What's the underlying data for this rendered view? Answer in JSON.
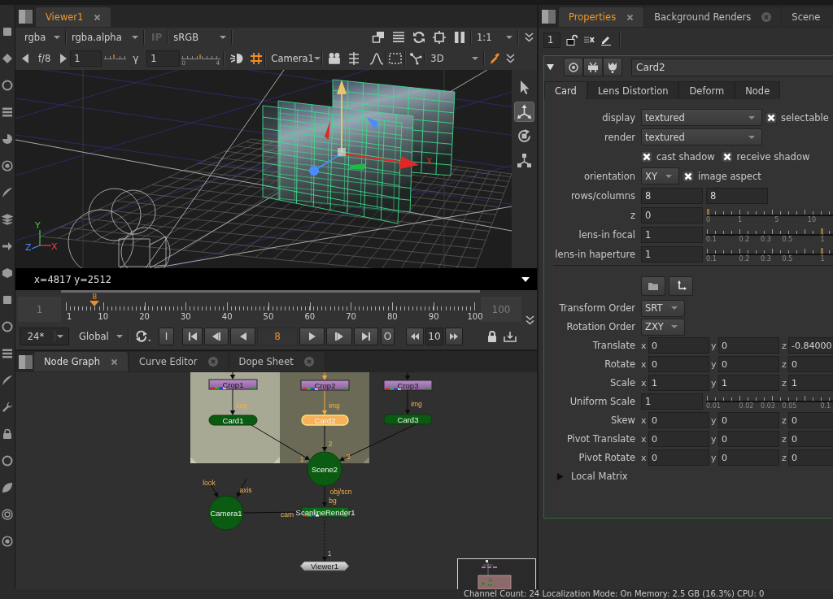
{
  "viewer": {
    "tab": {
      "label": "Viewer1",
      "selected": true,
      "closable": true
    },
    "toolbar": {
      "channels": "rgba",
      "alpha": "rgba.alpha",
      "input_process": {
        "label": "IP",
        "disabled": true
      },
      "colorspace": "sRGB",
      "zoom": "1:1"
    },
    "controls": {
      "fstop": "f/8",
      "gain": {
        "value": "1",
        "level": 0.45
      },
      "gamma": {
        "label": "γ",
        "value": "1",
        "level": 0.47,
        "ticks": [
          "0",
          "4"
        ]
      },
      "camera": "Camera1",
      "view_mode": "3D"
    },
    "viewport": {
      "tools": [
        {
          "selected": false
        },
        {
          "selected": true
        },
        {
          "selected": false
        },
        {
          "selected": false
        }
      ],
      "gizmo_label": "X",
      "axis_labels": [
        "Y",
        "Z",
        "X"
      ]
    },
    "info": "x=4817 y=2512",
    "timeline": {
      "start": "1",
      "end": "100",
      "ticks": [
        "1",
        "10",
        "20",
        "30",
        "40",
        "50",
        "60",
        "70",
        "80",
        "90",
        "100"
      ],
      "current": "8",
      "level": 0.07
    },
    "playback": {
      "fps": "24*",
      "range": "Global",
      "in_label": "I",
      "frame": "8",
      "out_label": "O",
      "increment": "10"
    }
  },
  "node_graph": {
    "tabs": [
      {
        "label": "Node Graph",
        "selected": true,
        "closable": true
      },
      {
        "label": "Curve Editor",
        "selected": false,
        "closable": true
      },
      {
        "label": "Dope Sheet",
        "selected": false,
        "closable": true
      }
    ],
    "nodes": [
      {
        "kind": "crop",
        "label": "Crop1",
        "selected": false
      },
      {
        "kind": "crop",
        "label": "Crop2",
        "selected": false
      },
      {
        "kind": "crop",
        "label": "Crop3",
        "selected": false
      },
      {
        "kind": "card",
        "label": "Card1",
        "selected": false,
        "inputs": [
          "img"
        ]
      },
      {
        "kind": "card",
        "label": "Card2",
        "selected": true,
        "inputs": [
          "img"
        ]
      },
      {
        "kind": "card",
        "label": "Card3",
        "selected": false,
        "inputs": [
          "img"
        ]
      },
      {
        "kind": "scene",
        "label": "Scene2",
        "selected": false,
        "inputs": [
          "1",
          "2",
          "3"
        ]
      },
      {
        "kind": "camera",
        "label": "Camera1",
        "selected": false,
        "inputs": [
          "look",
          "axis"
        ]
      },
      {
        "kind": "render",
        "label": "ScanlineRender1",
        "selected": false,
        "inputs": [
          "obj/scn",
          "bg",
          "cam"
        ]
      },
      {
        "kind": "viewer",
        "label": "Viewer1",
        "selected": false,
        "inputs": [
          "1"
        ]
      }
    ]
  },
  "properties": {
    "tabs": [
      {
        "label": "Properties",
        "selected": true,
        "closable": true
      },
      {
        "label": "Background Renders",
        "selected": false,
        "closable": true
      },
      {
        "label": "Scene",
        "selected": false,
        "closable": false
      }
    ],
    "max_panels": "1",
    "node": {
      "name": "Card2",
      "expanded": true,
      "tabs": [
        {
          "label": "Card",
          "selected": true
        },
        {
          "label": "Lens Distortion",
          "selected": false
        },
        {
          "label": "Deform",
          "selected": false
        },
        {
          "label": "Node",
          "selected": false
        }
      ],
      "knobs": [
        {
          "kind": "dropdown",
          "label": "display",
          "value": "textured",
          "checkbox": {
            "label": "selectable",
            "checked": true
          }
        },
        {
          "kind": "dropdown",
          "label": "render",
          "value": "textured"
        },
        {
          "kind": "checkboxes",
          "items": [
            {
              "label": "cast shadow",
              "checked": true
            },
            {
              "label": "receive shadow",
              "checked": true
            }
          ]
        },
        {
          "kind": "dropdown",
          "label": "orientation",
          "value": "XY",
          "checkbox": {
            "label": "image aspect",
            "checked": true
          }
        },
        {
          "kind": "pair",
          "label": "rows/columns",
          "values": [
            "8",
            "8"
          ]
        },
        {
          "kind": "slider",
          "label": "z",
          "value": "0",
          "level": 0,
          "ticks": [
            "0",
            "1",
            "5",
            "10"
          ]
        },
        {
          "kind": "slider",
          "label": "lens-in focal",
          "value": "1",
          "level": 0.9,
          "ticks": [
            "0.1",
            "0.2",
            "0.3",
            "0.5",
            "1"
          ]
        },
        {
          "kind": "slider",
          "label": "lens-in haperture",
          "value": "1",
          "level": 0.9,
          "ticks": [
            "0.1",
            "0.2",
            "0.3",
            "0.5",
            "1"
          ]
        }
      ],
      "transform_knobs": [
        {
          "kind": "dropdown",
          "label": "Transform Order",
          "value": "SRT"
        },
        {
          "kind": "dropdown",
          "label": "Rotation Order",
          "value": "ZXY"
        },
        {
          "kind": "xyz",
          "label": "Translate",
          "fields": [
            {
              "axis": "x",
              "value": "0"
            },
            {
              "axis": "y",
              "value": "0"
            },
            {
              "axis": "z",
              "value": "-0.84000"
            }
          ]
        },
        {
          "kind": "xyz",
          "label": "Rotate",
          "fields": [
            {
              "axis": "x",
              "value": "0"
            },
            {
              "axis": "y",
              "value": "0"
            },
            {
              "axis": "z",
              "value": "0"
            }
          ]
        },
        {
          "kind": "xyz",
          "label": "Scale",
          "fields": [
            {
              "axis": "x",
              "value": "1"
            },
            {
              "axis": "y",
              "value": "1"
            },
            {
              "axis": "z",
              "value": "1"
            }
          ]
        },
        {
          "kind": "slider",
          "label": "Uniform Scale",
          "value": "1",
          "ticks": [
            "0.01",
            "0.02",
            "0.03",
            "0.05",
            "0.1"
          ]
        },
        {
          "kind": "xyz",
          "label": "Skew",
          "fields": [
            {
              "axis": "x",
              "value": "0"
            },
            {
              "axis": "y",
              "value": "0"
            },
            {
              "axis": "z",
              "value": "0"
            }
          ]
        },
        {
          "kind": "xyz",
          "label": "Pivot Translate",
          "fields": [
            {
              "axis": "x",
              "value": "0"
            },
            {
              "axis": "y",
              "value": "0"
            },
            {
              "axis": "z",
              "value": "0"
            }
          ]
        },
        {
          "kind": "xyz",
          "label": "Pivot Rotate",
          "fields": [
            {
              "axis": "x",
              "value": "0"
            },
            {
              "axis": "y",
              "value": "0"
            },
            {
              "axis": "z",
              "value": "0"
            }
          ]
        }
      ],
      "local_matrix": {
        "label": "Local Matrix",
        "expanded": false
      }
    }
  },
  "status_bar": "Channel Count: 24 Localization Mode: On Memory: 2.5 GB (16.3%) CPU: 0"
}
